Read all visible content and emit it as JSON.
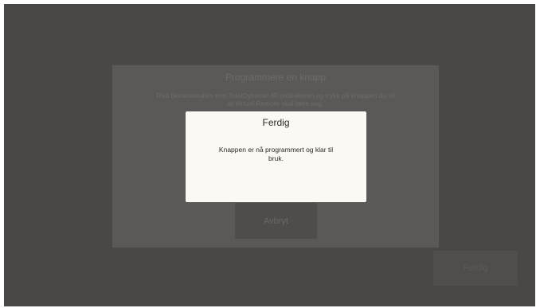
{
  "background_dialog": {
    "title": "Programmere en knapp",
    "instruction": "Rett fjernkontrollen mot TotalDynamic-IR-mottakeren og trykk på knappen du vil at Virtual Remote skal lære seg.",
    "cancel_label": "Avbryt"
  },
  "corner_button": {
    "label": "Ferdig"
  },
  "modal": {
    "title": "Ferdig",
    "message": "Knappen er nå programmert og klar til bruk."
  },
  "colors": {
    "overlay": "#4a4846",
    "modal_background": "#fbf9f4",
    "text_dark": "#2a2928"
  }
}
